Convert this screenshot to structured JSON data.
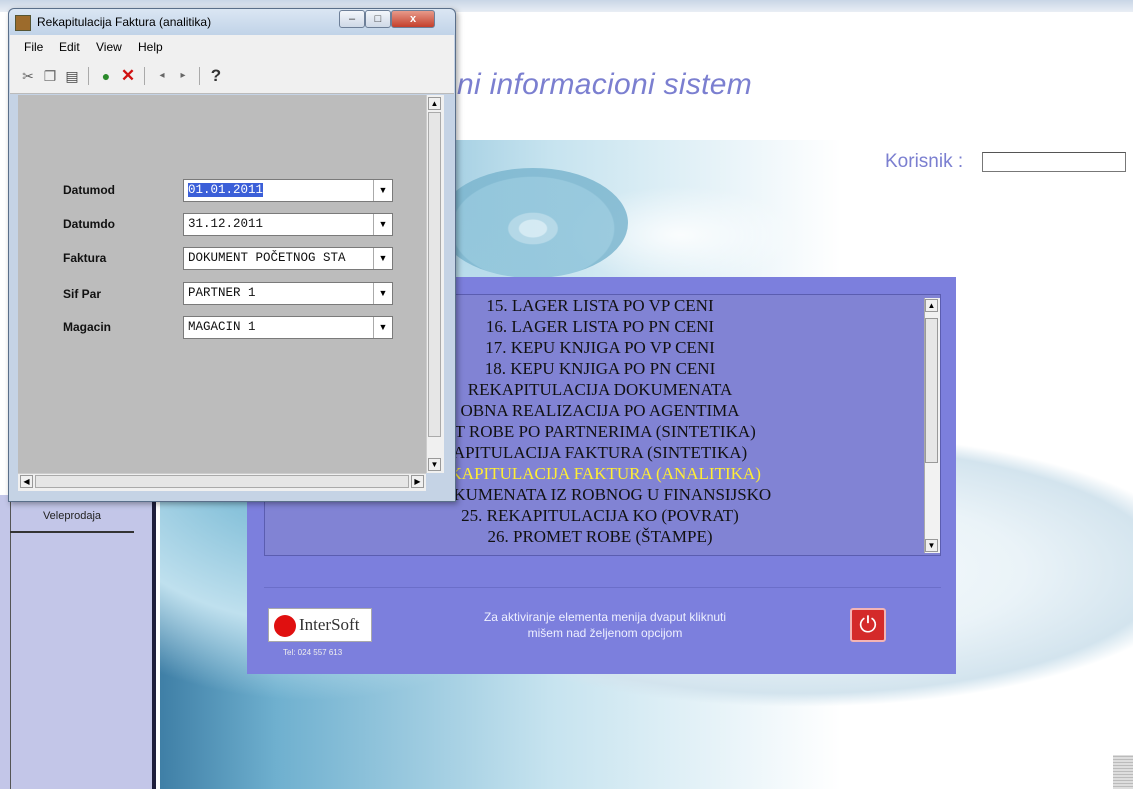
{
  "app": {
    "title_fragment": "ni informacioni sistem",
    "user_label": "Korisnik :",
    "user_value": "",
    "sidebar_item": "Veleprodaja"
  },
  "menu": {
    "items": [
      {
        "label": "15. LAGER LISTA PO VP CENI",
        "selected": false
      },
      {
        "label": "16. LAGER LISTA PO PN CENI",
        "selected": false
      },
      {
        "label": "17. KEPU KNJIGA PO VP CENI",
        "selected": false
      },
      {
        "label": "18. KEPU KNJIGA PO PN CENI",
        "selected": false
      },
      {
        "label": "REKAPITULACIJA DOKUMENATA",
        "selected": false
      },
      {
        "label": "OBNA REALIZACIJA PO AGENTIMA",
        "selected": false
      },
      {
        "label": "ET ROBE PO PARTNERIMA (SINTETIKA)",
        "selected": false
      },
      {
        "label": "APITULACIJA FAKTURA (SINTETIKA)",
        "selected": false
      },
      {
        "label": "EKAPITULACIJA FAKTURA (ANALITIKA)",
        "selected": true
      },
      {
        "label": "DOKUMENATA IZ ROBNOG U FINANSIJSKO",
        "selected": false
      },
      {
        "label": "25. REKAPITULACIJA KO (POVRAT)",
        "selected": false
      },
      {
        "label": "26. PROMET ROBE (ŠTAMPE)",
        "selected": false
      }
    ],
    "hint_line1": "Za aktiviranje elementa menija dvaput kliknuti",
    "hint_line2": "mišem nad željenom opcijom",
    "logo_text": "InterSoft",
    "tel": "Tel: 024 557 613",
    "power_icon": "power-icon",
    "colors": {
      "panel": "#7c7fdd",
      "selected_item": "#ffee33"
    }
  },
  "dialog": {
    "title": "Rekapitulacija Faktura (analitika)",
    "window_buttons": {
      "minimize": "–",
      "maximize": "□",
      "close": "x"
    },
    "menubar": [
      "File",
      "Edit",
      "View",
      "Help"
    ],
    "toolbar_icons": [
      "cut-icon",
      "copy-icon",
      "paste-icon",
      "run-icon",
      "delete-icon",
      "prev-icon",
      "next-icon",
      "help-icon"
    ],
    "toolbar_help_label": "?",
    "fields": [
      {
        "label": "Datumod",
        "value": "01.01.2011",
        "selected": true
      },
      {
        "label": "Datumdo",
        "value": "31.12.2011",
        "selected": false
      },
      {
        "label": "Faktura",
        "value": "DOKUMENT POČETNOG STA",
        "selected": false
      },
      {
        "label": "Sif Par",
        "value": "PARTNER 1",
        "selected": false
      },
      {
        "label": "Magacin",
        "value": "MAGACIN 1",
        "selected": false
      }
    ]
  }
}
